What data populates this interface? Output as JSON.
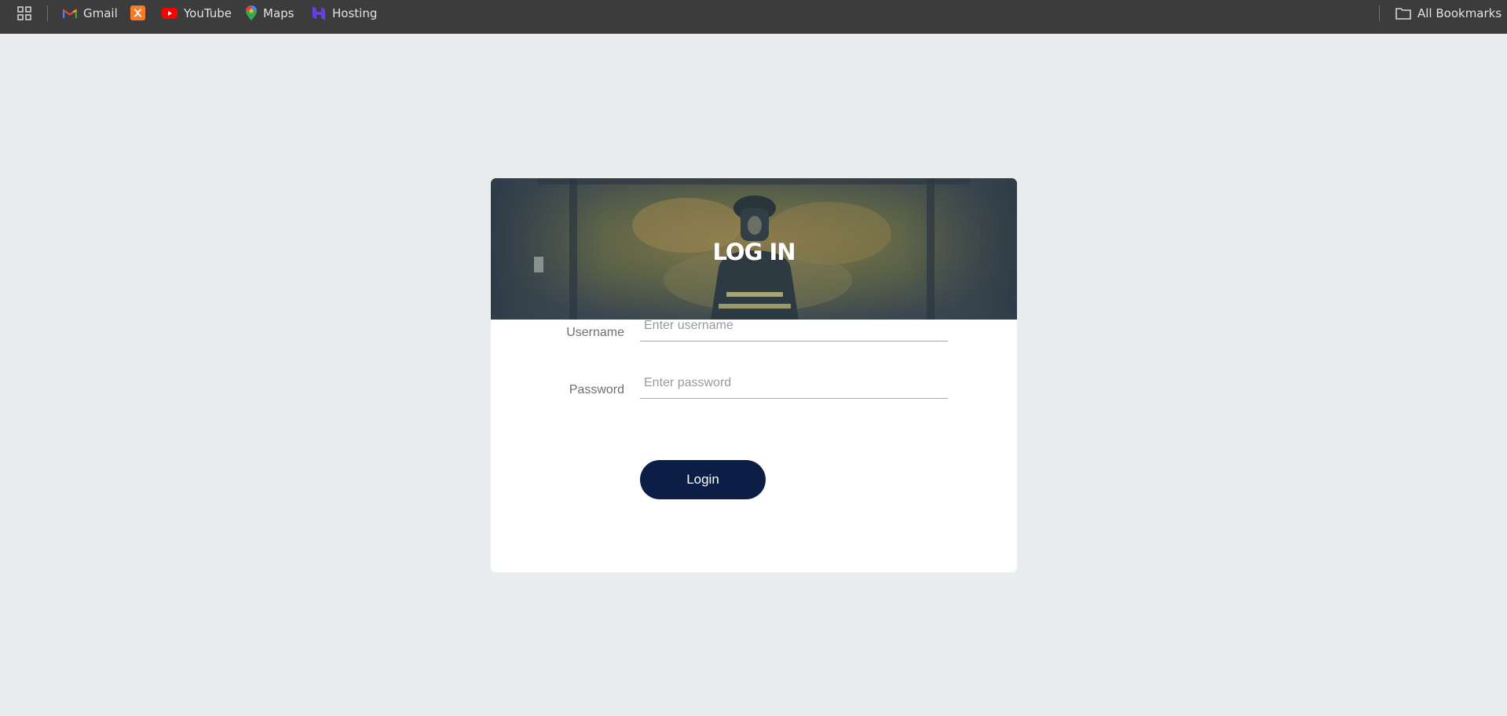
{
  "bookmarks_bar": {
    "items": [
      {
        "label": "Gmail",
        "icon": "gmail-icon"
      },
      {
        "label": "",
        "icon": "xampp-icon"
      },
      {
        "label": "YouTube",
        "icon": "youtube-icon"
      },
      {
        "label": "Maps",
        "icon": "maps-pin-icon"
      },
      {
        "label": "Hosting",
        "icon": "hosting-icon"
      }
    ],
    "all_bookmarks": "All Bookmarks"
  },
  "login": {
    "title": "LOG IN",
    "username_label": "Username",
    "username_placeholder": "Enter username",
    "password_label": "Password",
    "password_placeholder": "Enter password",
    "submit_label": "Login"
  },
  "colors": {
    "page_background": "#e9edee",
    "bar_background": "#3c3c3c",
    "button": "#0c1e45",
    "card": "#ffffff"
  }
}
